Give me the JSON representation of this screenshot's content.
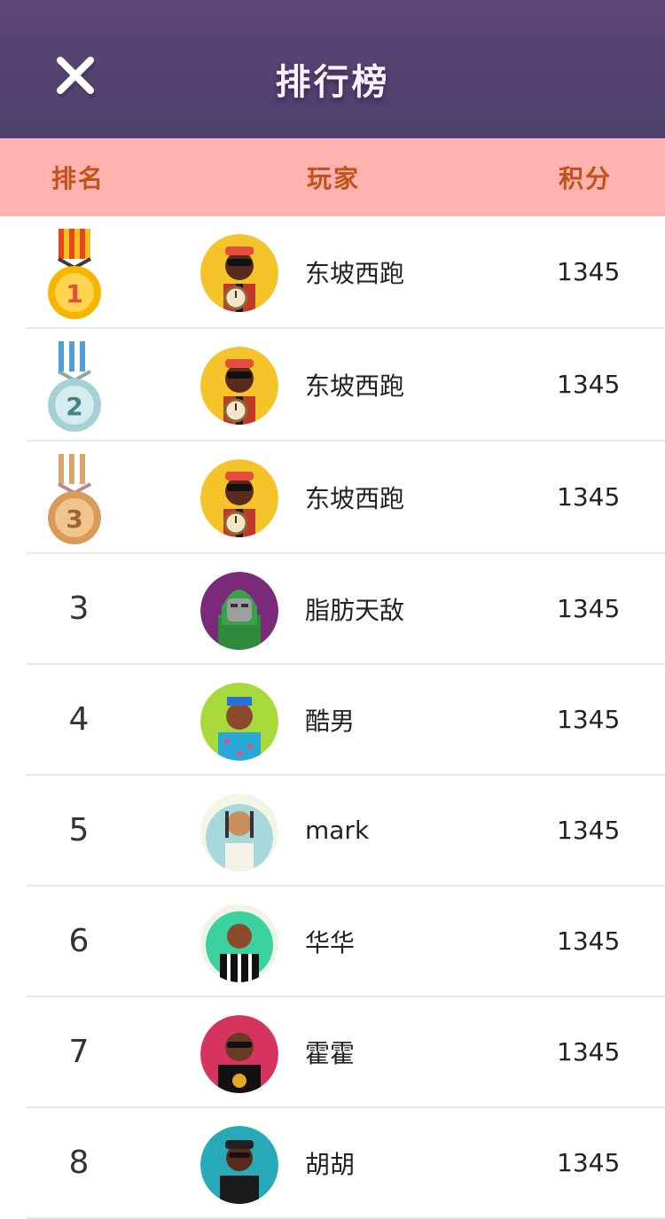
{
  "header": {
    "title": "排行榜",
    "close_icon": "close-icon"
  },
  "columns": {
    "rank": "排名",
    "player": "玩家",
    "score": "积分"
  },
  "colors": {
    "header": "#534372",
    "column_bar": "#ffb2af",
    "column_text": "#c0521a",
    "gold": "#f7b500",
    "silver": "#a6d1d4",
    "bronze": "#d99b5a"
  },
  "rows": [
    {
      "rank": "1",
      "medal": "gold-medal-icon",
      "avatar": "gold-chain-avatar",
      "name": "东坡西跑",
      "score": "1345"
    },
    {
      "rank": "2",
      "medal": "silver-medal-icon",
      "avatar": "gold-chain-avatar",
      "name": "东坡西跑",
      "score": "1345"
    },
    {
      "rank": "3",
      "medal": "bronze-medal-icon",
      "avatar": "gold-chain-avatar",
      "name": "东坡西跑",
      "score": "1345"
    },
    {
      "rank": "3",
      "avatar": "masked-avatar",
      "name": "脂肪天敌",
      "score": "1345"
    },
    {
      "rank": "4",
      "avatar": "hawaiian-shirt-avatar",
      "name": "酷男",
      "score": "1345"
    },
    {
      "rank": "5",
      "avatar": "braids-avatar",
      "name": "mark",
      "score": "1345"
    },
    {
      "rank": "6",
      "avatar": "striped-shirt-avatar",
      "name": "华华",
      "score": "1345"
    },
    {
      "rank": "7",
      "avatar": "sunglasses-chain-avatar",
      "name": "霍霍",
      "score": "1345"
    },
    {
      "rank": "8",
      "avatar": "cap-avatar",
      "name": "胡胡",
      "score": "1345"
    }
  ]
}
